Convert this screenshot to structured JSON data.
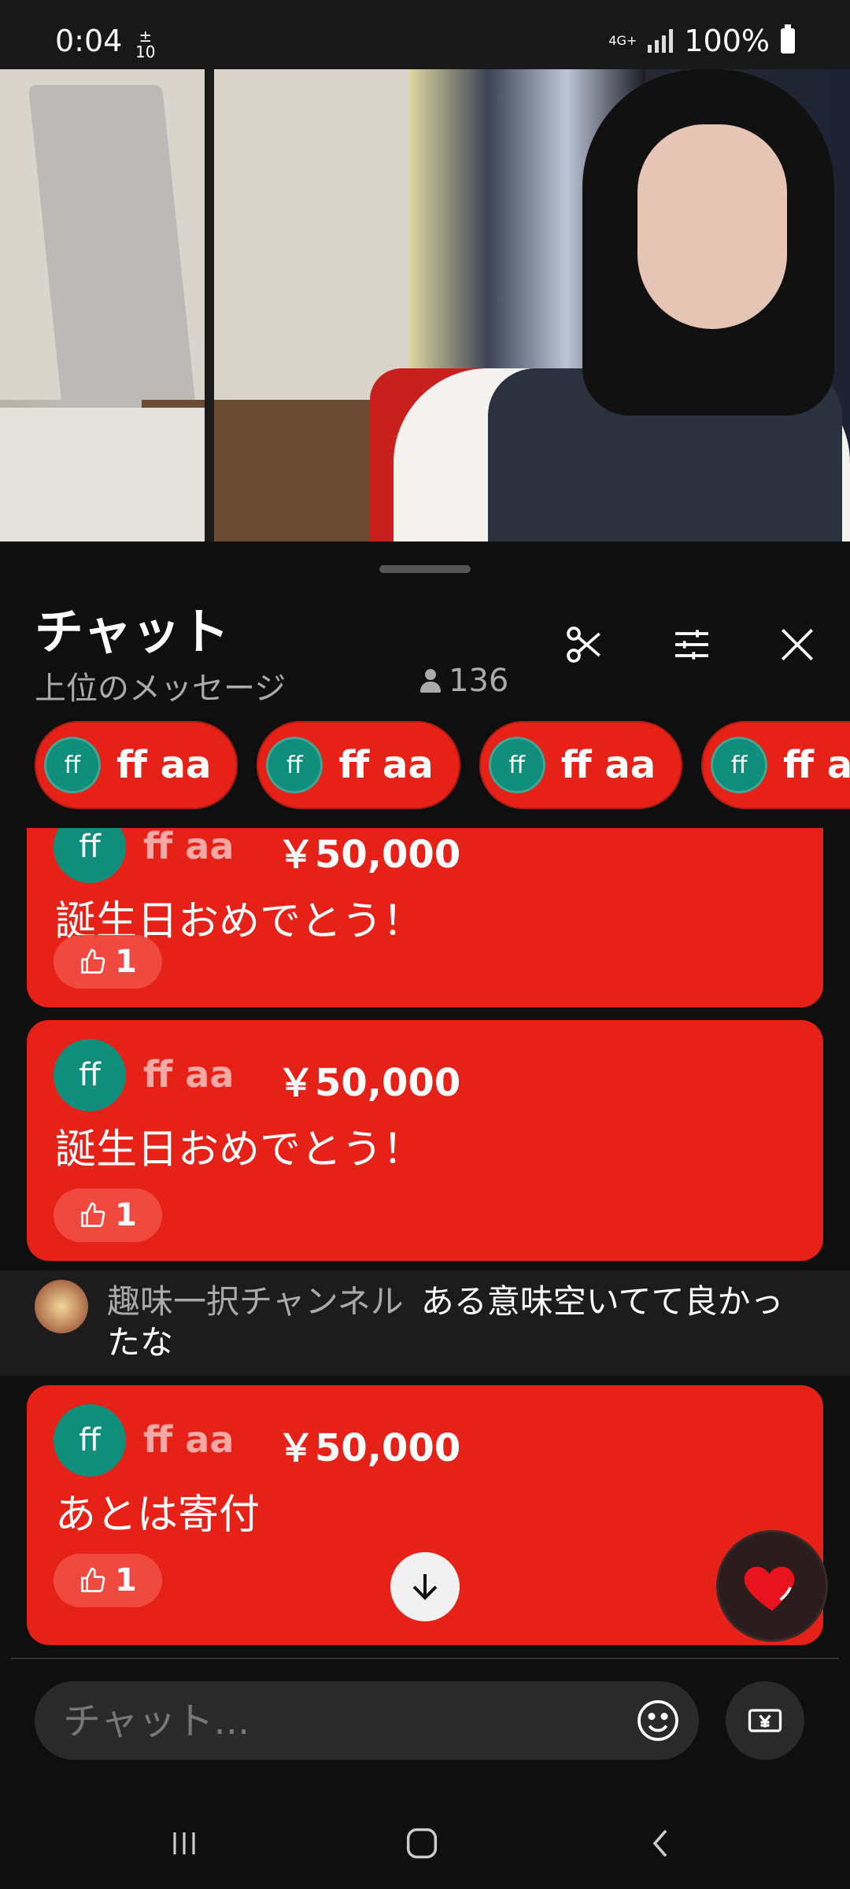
{
  "status_bar": {
    "time": "0:04",
    "tenth_top": "±",
    "tenth_bottom": "10",
    "network": "4G+",
    "battery": "100%"
  },
  "chat": {
    "title": "チャット",
    "subtitle": "上位のメッセージ",
    "viewer_count": "136",
    "pinned_chips": [
      {
        "avatar": "ff",
        "name": "ff aa"
      },
      {
        "avatar": "ff",
        "name": "ff aa"
      },
      {
        "avatar": "ff",
        "name": "ff aa"
      },
      {
        "avatar": "ff",
        "name": "ff aa"
      }
    ],
    "messages": [
      {
        "avatar": "ff",
        "author": "ff aa",
        "amount": "￥50,000",
        "text": "誕生日おめでとう！",
        "likes": "1"
      },
      {
        "avatar": "ff",
        "author": "ff aa",
        "amount": "￥50,000",
        "text": "誕生日おめでとう！",
        "likes": "1"
      },
      {
        "author": "趣味一択チャンネル",
        "text": "ある意味空いてて良かったな"
      },
      {
        "avatar": "ff",
        "author": "ff aa",
        "amount": "￥50,000",
        "text": "あとは寄付",
        "likes": "1"
      }
    ],
    "input_placeholder": "チャット..."
  },
  "colors": {
    "superchat_red": "#e62117",
    "avatar_teal": "#0f8f7b",
    "background": "#0f0f0f"
  },
  "icons": [
    "scissors-icon",
    "tune-icon",
    "close-icon",
    "person-icon",
    "thumb-up-icon",
    "arrow-down-icon",
    "heart-icon",
    "emoji-icon",
    "yen-icon",
    "recents-icon",
    "home-icon",
    "back-icon"
  ]
}
